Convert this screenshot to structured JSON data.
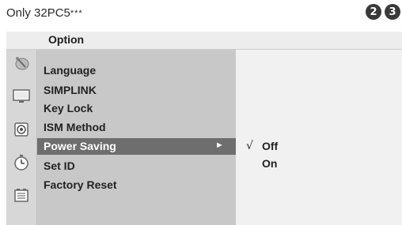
{
  "note": "Only 32PC5",
  "note_marks": "***",
  "badges": [
    "2",
    "3"
  ],
  "menu": {
    "title": "Option",
    "sidebar_icons": [
      "setup-icon",
      "picture-icon",
      "audio-icon",
      "time-icon",
      "option-icon"
    ],
    "items": [
      {
        "label": "Language"
      },
      {
        "label": "SIMPLINK"
      },
      {
        "label": "Key Lock"
      },
      {
        "label": "ISM Method"
      },
      {
        "label": "Power Saving",
        "selected": true
      },
      {
        "label": "Set ID"
      },
      {
        "label": "Factory Reset"
      }
    ],
    "selected_arrow": "►",
    "options": {
      "check_mark": "√",
      "items": [
        {
          "label": "Off",
          "checked": true
        },
        {
          "label": "On",
          "checked": false
        }
      ]
    }
  },
  "colors": {
    "header_bg": "#ededed",
    "submenu_bg": "#c8c8c8",
    "selected_bg": "#6e6e6e",
    "options_bg": "#f1f1f1",
    "badge_bg": "#3a3a3a"
  }
}
